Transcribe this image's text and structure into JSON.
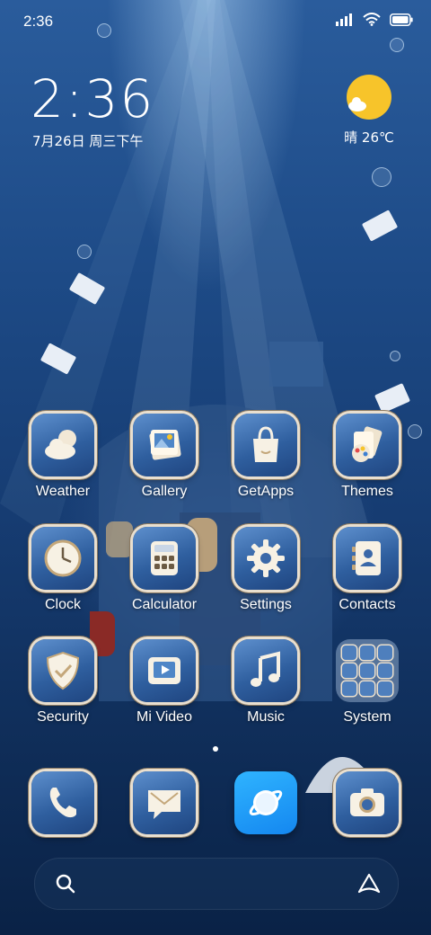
{
  "status_bar": {
    "time": "2:36"
  },
  "clock_widget": {
    "time": "2:36",
    "date": "7月26日 周三下午"
  },
  "weather_widget": {
    "text": "晴 26℃"
  },
  "apps": [
    {
      "label": "Weather",
      "icon": "weather-icon"
    },
    {
      "label": "Gallery",
      "icon": "gallery-icon"
    },
    {
      "label": "GetApps",
      "icon": "shopping-bag-icon"
    },
    {
      "label": "Themes",
      "icon": "palette-icon"
    },
    {
      "label": "Clock",
      "icon": "clock-icon"
    },
    {
      "label": "Calculator",
      "icon": "calculator-icon"
    },
    {
      "label": "Settings",
      "icon": "gear-icon"
    },
    {
      "label": "Contacts",
      "icon": "contacts-icon"
    },
    {
      "label": "Security",
      "icon": "shield-icon"
    },
    {
      "label": "Mi Video",
      "icon": "video-icon"
    },
    {
      "label": "Music",
      "icon": "music-note-icon"
    },
    {
      "label": "System",
      "icon": "folder-icon"
    }
  ],
  "dock": [
    {
      "icon": "phone-icon"
    },
    {
      "icon": "message-icon"
    },
    {
      "icon": "browser-icon"
    },
    {
      "icon": "camera-icon"
    }
  ],
  "colors": {
    "accent": "#1487f0",
    "icon_frame": "#e9dfcf",
    "sun": "#f7c42a"
  }
}
